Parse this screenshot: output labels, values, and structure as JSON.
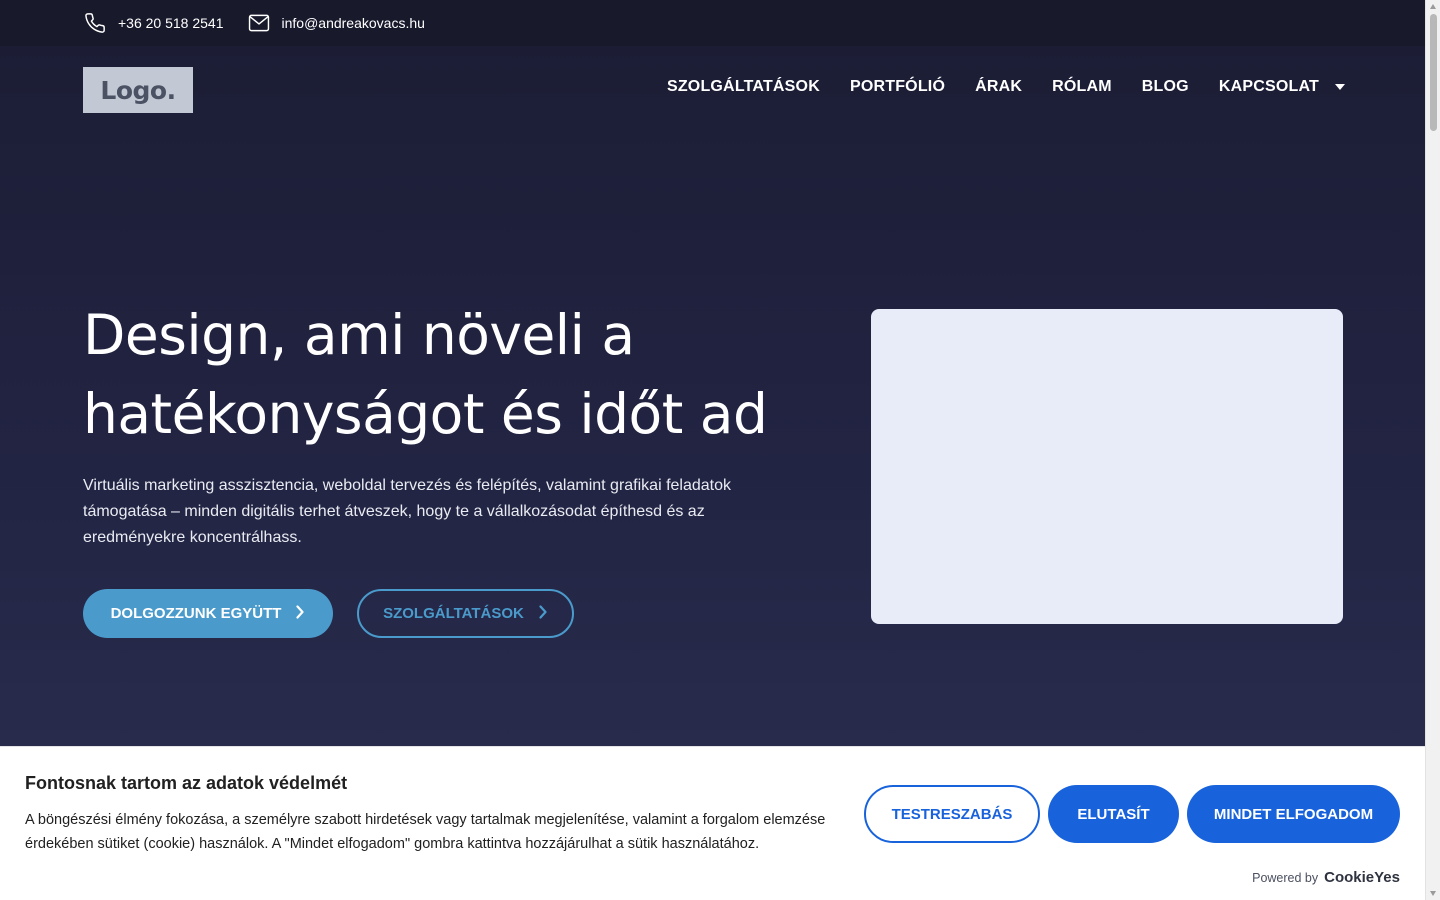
{
  "topbar": {
    "phone": "+36 20 518 2541",
    "email": "info@andreakovacs.hu",
    "phone_icon": "phone-icon",
    "email_icon": "envelope-icon"
  },
  "logo": {
    "text": "Logo."
  },
  "nav": {
    "items": [
      {
        "label": "SZOLGÁLTATÁSOK"
      },
      {
        "label": "PORTFÓLIÓ"
      },
      {
        "label": "ÁRAK"
      },
      {
        "label": "RÓLAM"
      },
      {
        "label": "BLOG"
      },
      {
        "label": "KAPCSOLAT"
      }
    ]
  },
  "hero": {
    "headline_line1": "Design, ami növeli a",
    "headline_line2": "hatékonyságot és időt ad",
    "subtitle": "Virtuális marketing asszisztencia, weboldal tervezés és felépítés, valamint grafikai feladatok támogatása – minden digitális terhet átveszek, hogy te a vállalkozásodat építhesd és az eredményekre koncentrálhass.",
    "primary_button": "DOLGOZZUNK EGYÜTT",
    "secondary_button": "SZOLGÁLTATÁSOK"
  },
  "cookie_banner": {
    "title": "Fontosnak tartom az adatok védelmét",
    "text": "A böngészési élmény fokozása, a személyre szabott hirdetések vagy tartalmak megjelenítése, valamint a forgalom elemzése érdekében sütiket (cookie) használok. A \"Mindet elfogadom\" gombra kattintva hozzájárulhat a sütik használatához.",
    "customize_button": "TESTRESZABÁS",
    "reject_button": "ELUTASÍT",
    "accept_button": "MINDET ELFOGADOM",
    "powered_by": "Powered by",
    "brand": "CookieYes"
  },
  "colors": {
    "hero_bg": "#1f2038",
    "topbar_bg": "#181a2c",
    "accent": "#4a9bcc",
    "cookie_button": "#1863dc",
    "image_placeholder": "#e8ecf8"
  }
}
